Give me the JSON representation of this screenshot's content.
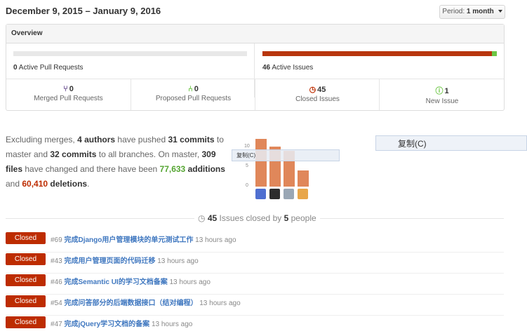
{
  "header": {
    "date_range": "December 9, 2015 – January 9, 2016",
    "period_label": "Period:",
    "period_value": "1 month"
  },
  "overview": {
    "title": "Overview",
    "active_pull_requests": {
      "count": "0",
      "label": "Active Pull Requests"
    },
    "active_issues": {
      "count": "46",
      "label": "Active Issues"
    },
    "cells": [
      {
        "count": "0",
        "label": "Merged Pull Requests",
        "icon": "git-merge-icon",
        "color": "#6e5494"
      },
      {
        "count": "0",
        "label": "Proposed Pull Requests",
        "icon": "git-pull-request-icon",
        "color": "#6cc644"
      },
      {
        "count": "45",
        "label": "Closed Issues",
        "icon": "issue-closed-icon",
        "color": "#bd2c00"
      },
      {
        "count": "1",
        "label": "New Issue",
        "icon": "issue-opened-icon",
        "color": "#6cc644"
      }
    ]
  },
  "summary": {
    "p1": "Excluding merges,",
    "authors": "4 authors",
    "p2": "have pushed",
    "commits_master": "31 commits",
    "p3": "to master and",
    "commits_all": "32 commits",
    "p4": "to all branches. On master,",
    "files": "309 files",
    "p5": "have changed and there have been",
    "additions": "77,633",
    "additions_word": "additions",
    "p6": "and",
    "deletions": "60,410",
    "deletions_word": "deletions",
    "p7": "."
  },
  "contributors_chart": {
    "y_ticks": [
      "10",
      "5",
      "0"
    ],
    "commits": [
      12,
      10,
      9,
      4
    ],
    "ylim": [
      0,
      13
    ],
    "avatar_colors": [
      "#4f6fd0",
      "#2d2d2d",
      "#9aa7b5",
      "#e8a64a"
    ]
  },
  "context_menu": {
    "small": "复制(C)",
    "large": "复制(C)"
  },
  "closed_summary": {
    "count": "45",
    "p1": "Issues closed by",
    "people": "5",
    "p2": "people"
  },
  "closed_issues": [
    {
      "badge": "Closed",
      "number": "#69",
      "title": "完成Django用户管理模块的单元测试工作",
      "time": "13 hours ago"
    },
    {
      "badge": "Closed",
      "number": "#43",
      "title": "完成用户管理页面的代码迁移",
      "time": "13 hours ago"
    },
    {
      "badge": "Closed",
      "number": "#46",
      "title": "完成Semantic UI的学习文档备案",
      "time": "13 hours ago"
    },
    {
      "badge": "Closed",
      "number": "#54",
      "title": "完成问答部分的后端数据接口（结对编程）",
      "time": "13 hours ago"
    },
    {
      "badge": "Closed",
      "number": "#47",
      "title": "完成jQuery学习文档的备案",
      "time": "13 hours ago"
    }
  ]
}
